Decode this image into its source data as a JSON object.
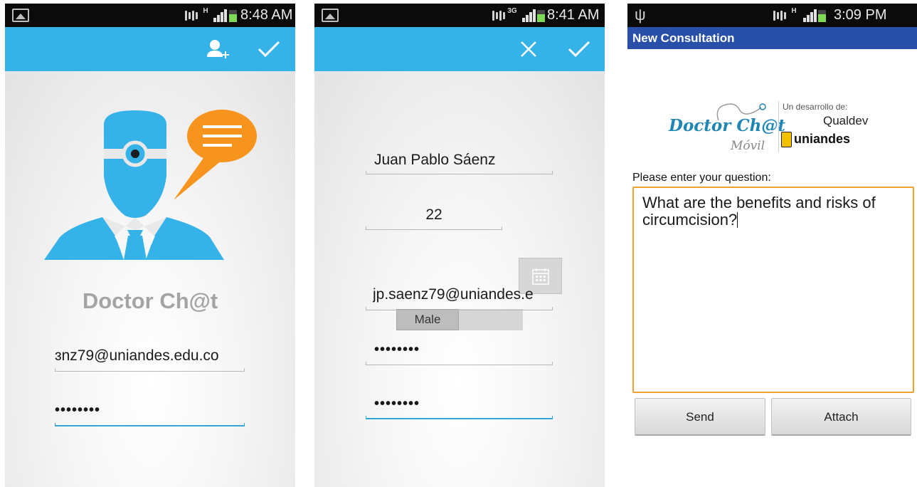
{
  "screens": [
    {
      "status_time": "8:48 AM",
      "network": "H",
      "app_title": "Doctor Ch@t",
      "email_value": "ɜnz79@uniandes.edu.co",
      "password_value": "••••••••",
      "icons": [
        "gallery-icon",
        "mute-icon",
        "signal-icon",
        "battery-icon",
        "add-contact-icon",
        "check-icon",
        "doctor-illustration",
        "chat-bubble-icon"
      ]
    },
    {
      "status_time": "8:41 AM",
      "network": "3G",
      "name_value": "Juan Pablo Sáenz",
      "age_value": "22",
      "gender_value": "Male",
      "email_value": "jp.saenz79@uniandes.e",
      "password_value": "••••••••",
      "confirm_password_value": "••••••••",
      "icons": [
        "gallery-icon",
        "mute-icon",
        "signal-icon",
        "battery-icon",
        "close-icon",
        "check-icon",
        "calendar-icon"
      ]
    },
    {
      "status_time": "3:09 PM",
      "network": "H",
      "title": "New Consultation",
      "logo": {
        "brand": "Doctor Ch@t",
        "brand_sub": "Móvil",
        "dev_caption": "Un desarrollo de:",
        "dev1": "Qualdev",
        "dev2": "uniandes"
      },
      "prompt": "Please enter your question:",
      "question": "What are the benefits and risks of circumcision?",
      "send_label": "Send",
      "attach_label": "Attach",
      "icons": [
        "usb-icon",
        "mute-icon",
        "signal-icon",
        "battery-charging-icon"
      ]
    }
  ],
  "colors": {
    "action_bar": "#35b3e9",
    "consultation_bar": "#2850a8",
    "focus_line": "#33a7d6",
    "question_border": "#f3a02f",
    "speech_bubble": "#f7941d"
  }
}
